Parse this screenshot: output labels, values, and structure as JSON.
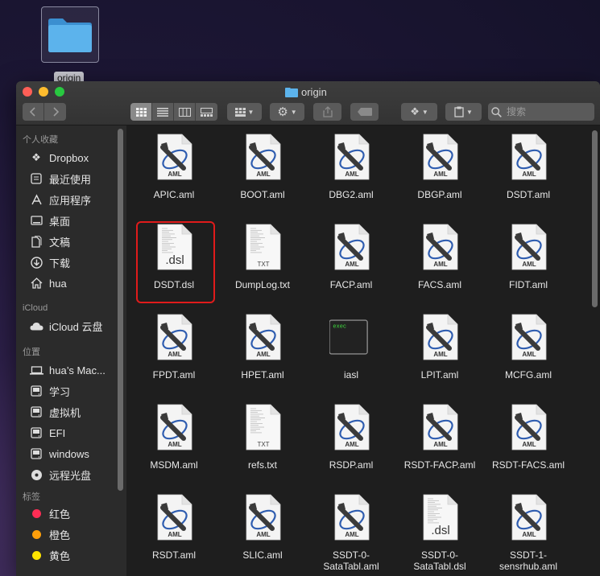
{
  "desktop": {
    "folder_label": "origin"
  },
  "window": {
    "title": "origin",
    "search_placeholder": "搜索"
  },
  "sidebar": {
    "sections": [
      {
        "label": "个人收藏",
        "items": [
          {
            "label": "Dropbox",
            "icon": "dropbox-icon"
          },
          {
            "label": "最近使用",
            "icon": "recents-icon"
          },
          {
            "label": "应用程序",
            "icon": "applications-icon"
          },
          {
            "label": "桌面",
            "icon": "desktop-icon"
          },
          {
            "label": "文稿",
            "icon": "documents-icon"
          },
          {
            "label": "下载",
            "icon": "downloads-icon"
          },
          {
            "label": "hua",
            "icon": "home-icon"
          }
        ]
      },
      {
        "label": "iCloud",
        "items": [
          {
            "label": "iCloud 云盘",
            "icon": "icloud-icon"
          }
        ]
      },
      {
        "label": "位置",
        "items": [
          {
            "label": "hua’s Mac...",
            "icon": "laptop-icon"
          },
          {
            "label": "学习",
            "icon": "disk-icon"
          },
          {
            "label": "虚拟机",
            "icon": "disk-icon"
          },
          {
            "label": "EFI",
            "icon": "disk-icon"
          },
          {
            "label": "windows",
            "icon": "disk-icon"
          },
          {
            "label": "远程光盘",
            "icon": "optical-disc-icon"
          }
        ]
      },
      {
        "label": "标签",
        "items": [
          {
            "label": "红色",
            "icon": "tag-dot-icon",
            "color": "#ff2d55"
          },
          {
            "label": "橙色",
            "icon": "tag-dot-icon",
            "color": "#ff9f0a"
          },
          {
            "label": "黄色",
            "icon": "tag-dot-icon",
            "color": "#ffe500"
          }
        ]
      }
    ]
  },
  "files": [
    {
      "name": "APIC.aml",
      "type": "aml"
    },
    {
      "name": "BOOT.aml",
      "type": "aml"
    },
    {
      "name": "DBG2.aml",
      "type": "aml"
    },
    {
      "name": "DBGP.aml",
      "type": "aml"
    },
    {
      "name": "DSDT.aml",
      "type": "aml"
    },
    {
      "name": "DSDT.dsl",
      "type": "dsl",
      "selected": true
    },
    {
      "name": "DumpLog.txt",
      "type": "txt"
    },
    {
      "name": "FACP.aml",
      "type": "aml"
    },
    {
      "name": "FACS.aml",
      "type": "aml"
    },
    {
      "name": "FIDT.aml",
      "type": "aml"
    },
    {
      "name": "FPDT.aml",
      "type": "aml"
    },
    {
      "name": "HPET.aml",
      "type": "aml"
    },
    {
      "name": "iasl",
      "type": "exec"
    },
    {
      "name": "LPIT.aml",
      "type": "aml"
    },
    {
      "name": "MCFG.aml",
      "type": "aml"
    },
    {
      "name": "MSDM.aml",
      "type": "aml"
    },
    {
      "name": "refs.txt",
      "type": "txt"
    },
    {
      "name": "RSDP.aml",
      "type": "aml"
    },
    {
      "name": "RSDT-FACP.aml",
      "type": "aml"
    },
    {
      "name": "RSDT-FACS.aml",
      "type": "aml"
    },
    {
      "name": "RSDT.aml",
      "type": "aml"
    },
    {
      "name": "SLIC.aml",
      "type": "aml"
    },
    {
      "name": "SSDT-0-SataTabl.aml",
      "type": "aml"
    },
    {
      "name": "SSDT-0-SataTabl.dsl",
      "type": "dsl"
    },
    {
      "name": "SSDT-1-sensrhub.aml",
      "type": "aml"
    }
  ],
  "icon_text": {
    "aml": "AML",
    "txt": "TXT",
    "dsl": ".dsl",
    "exec": "exec"
  },
  "colors": {
    "selection": "#e01b1b",
    "folder": "#4aa3e0"
  }
}
